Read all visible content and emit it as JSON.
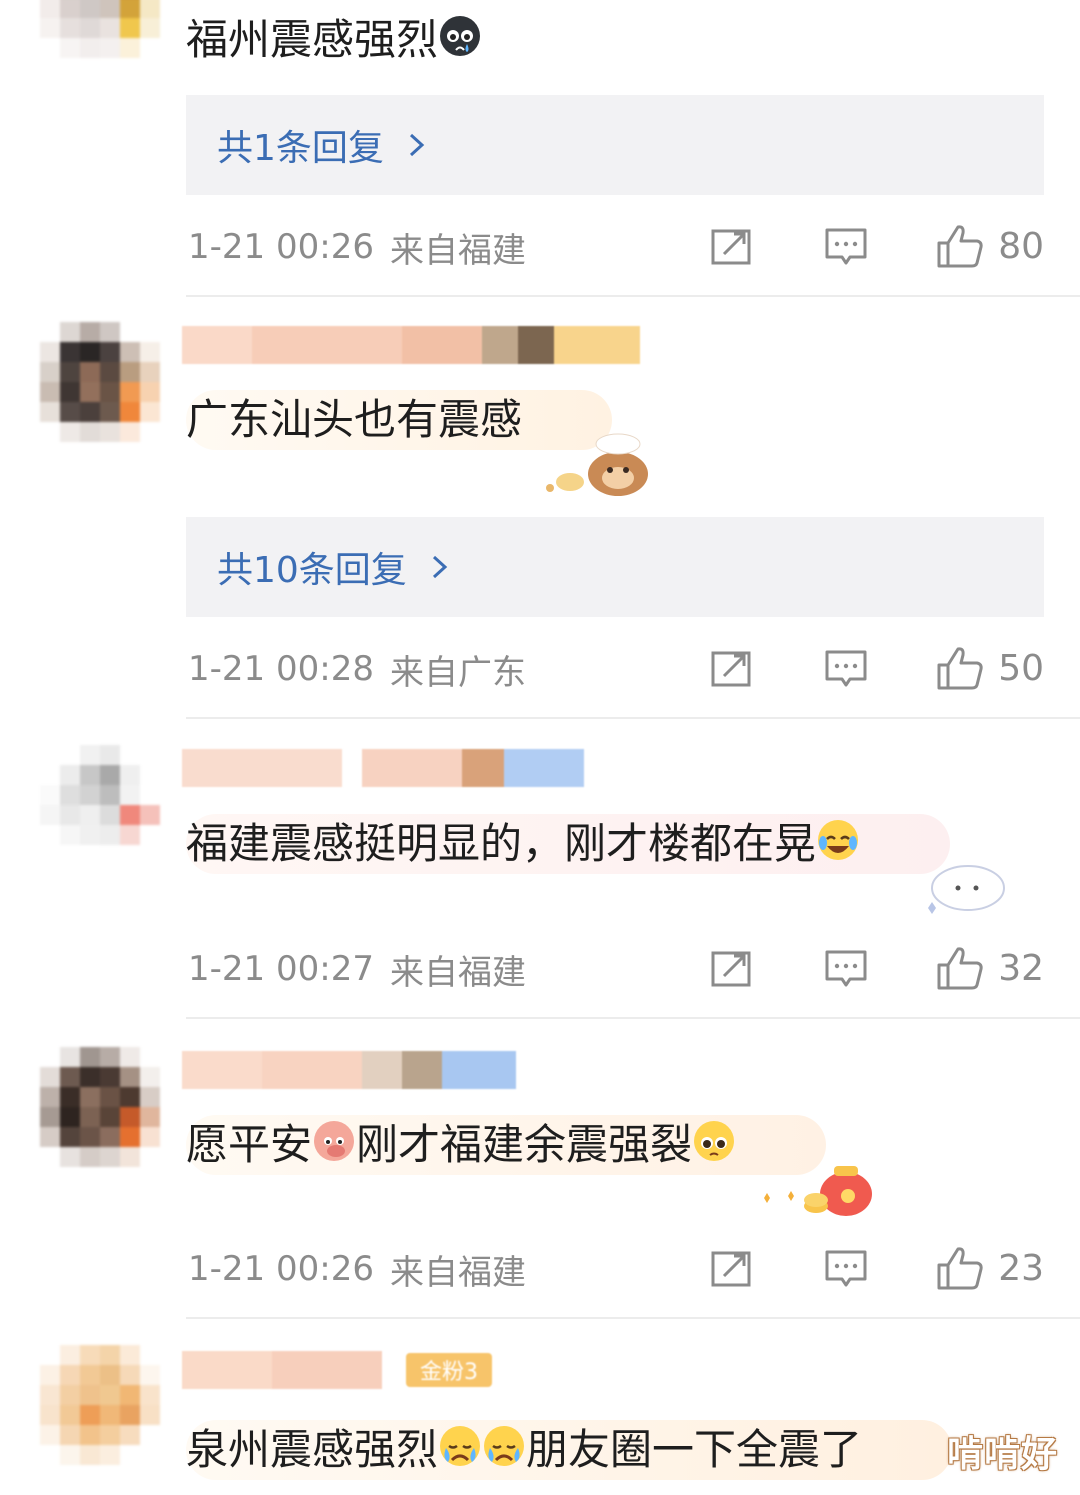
{
  "comments": [
    {
      "content": "福州震感强烈",
      "emojis": [
        "crying-face-emoji"
      ],
      "replies_label": "共1条回复",
      "time": "1-21 00:26",
      "location": "来自福建",
      "likes": "80"
    },
    {
      "content": "广东汕头也有震感",
      "emojis": [],
      "replies_label": "共10条回复",
      "time": "1-21 00:28",
      "location": "来自广东",
      "likes": "50"
    },
    {
      "content": "福建震感挺明显的，刚才楼都在晃",
      "emojis": [
        "laughing-tears-emoji"
      ],
      "time": "1-21 00:27",
      "location": "来自福建",
      "likes": "32"
    },
    {
      "content_part1": "愿平安",
      "content_part2": "刚才福建余震强裂",
      "emojis": [
        "pig-emoji",
        "pleading-face-emoji"
      ],
      "time": "1-21 00:26",
      "location": "来自福建",
      "likes": "23"
    },
    {
      "content_part1": "泉州震感强烈",
      "content_part2": "朋友圈一下全震了",
      "emojis": [
        "crying-face-emoji",
        "crying-face-emoji"
      ],
      "badge": "金粉3"
    }
  ],
  "watermark": "啃啃好",
  "icons": {
    "repost": "repost-icon",
    "comment": "comment-icon",
    "like": "thumbs-up-icon",
    "replies_chevron": "chevron-right-icon"
  },
  "colors": {
    "link": "#3b6db4",
    "meta": "#8b8b8b",
    "reply_bg": "#f2f2f4",
    "divider": "#ececec"
  }
}
